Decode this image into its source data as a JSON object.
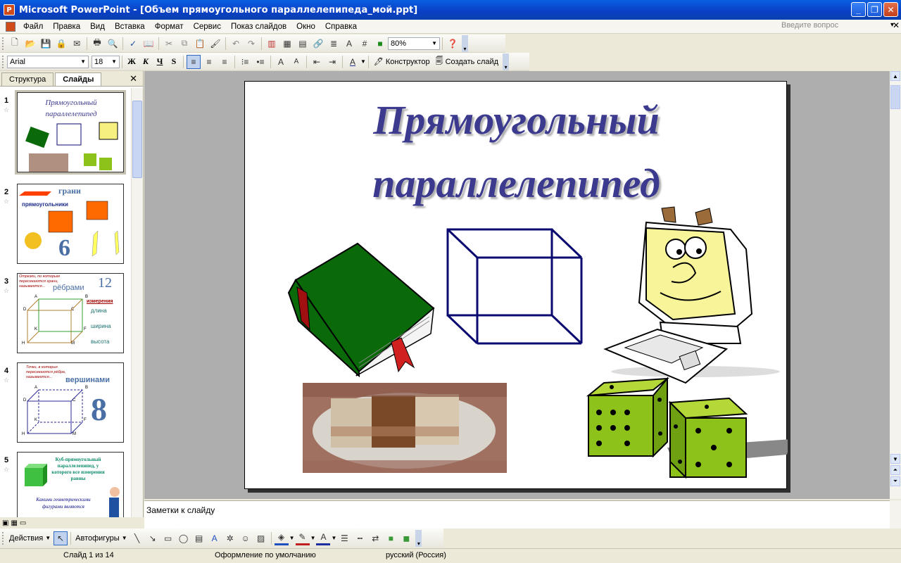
{
  "window": {
    "title": "Microsoft PowerPoint - [Объем прямоугольного параллелепипеда_мой.ppt]",
    "buttons": [
      "_",
      "❐",
      "✕"
    ]
  },
  "menu": {
    "items": [
      "Файл",
      "Правка",
      "Вид",
      "Вставка",
      "Формат",
      "Сервис",
      "Показ слайдов",
      "Окно",
      "Справка"
    ],
    "ask_placeholder": "Введите вопрос"
  },
  "toolbar_standard": {
    "zoom": "80%"
  },
  "toolbar_format": {
    "font": "Arial",
    "size": "18",
    "bold": "Ж",
    "italic": "К",
    "underline": "Ч",
    "shadow": "S",
    "designer": "Конструктор",
    "new_slide": "Создать слайд"
  },
  "left_pane": {
    "tabs": [
      "Структура",
      "Слайды"
    ],
    "slides": [
      {
        "num": "1",
        "title": "Прямоугольный параллелепипед"
      },
      {
        "num": "2",
        "t1": "грани",
        "t2": "прямоугольники",
        "n": "6"
      },
      {
        "num": "3",
        "t1": "Отрезки, по которым пересекаются грани, называются...",
        "t2": "рёбрами",
        "n": "12",
        "m1": "измерения",
        "m2": "длина",
        "m3": "ширина",
        "m4": "высота",
        "labels": [
          "A",
          "B",
          "C",
          "D",
          "K",
          "F",
          "H",
          "M"
        ]
      },
      {
        "num": "4",
        "t1": "Точки, в которых пересекаются рёбра, называются...",
        "t2": "вершинами",
        "n": "8",
        "labels": [
          "A",
          "B",
          "C",
          "D",
          "K",
          "F",
          "H",
          "M"
        ]
      },
      {
        "num": "5",
        "t1": "Куб-прямоугольный параллелепипед, у которого все измерения равны",
        "t2": "Какими геометрическими фигурами являются"
      }
    ]
  },
  "slide": {
    "title_line1": "Прямоугольный",
    "title_line2": "параллелепипед"
  },
  "notes": {
    "placeholder": "Заметки к слайду"
  },
  "drawing_toolbar": {
    "actions": "Действия",
    "autoshapes": "Автофигуры"
  },
  "status": {
    "slide": "Слайд 1 из 14",
    "design": "Оформление по умолчанию",
    "lang": "русский (Россия)"
  }
}
